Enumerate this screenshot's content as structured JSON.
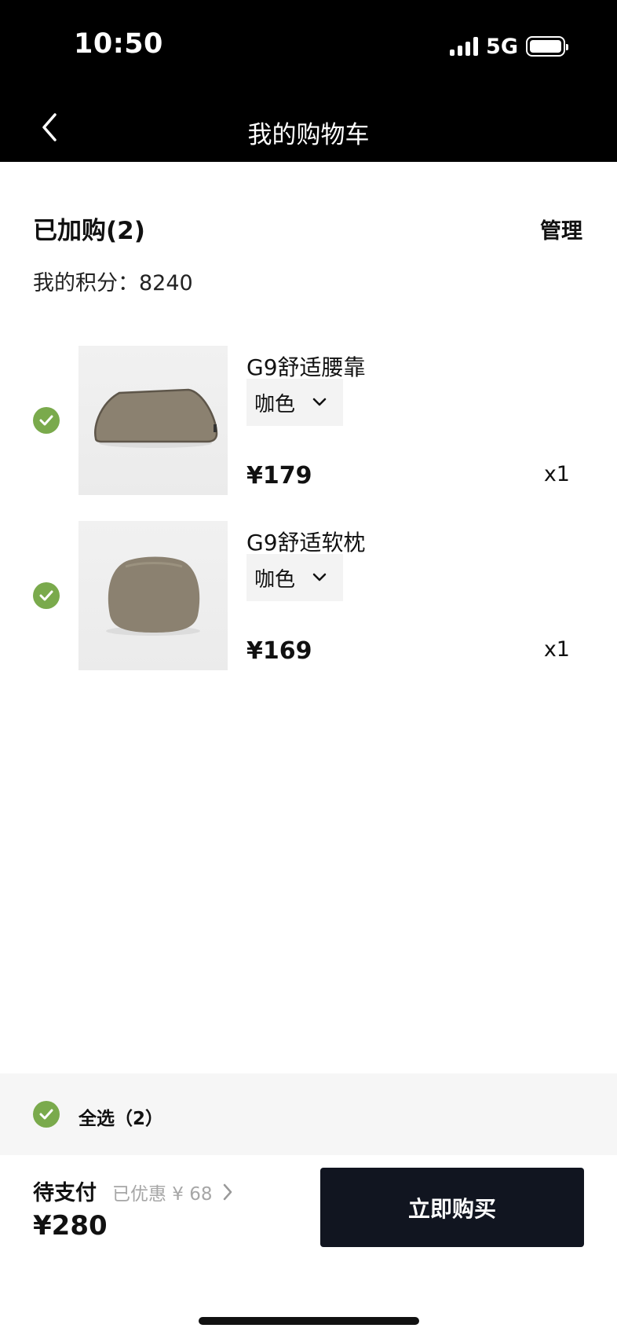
{
  "status_bar": {
    "time": "10:50",
    "network": "5G"
  },
  "nav": {
    "title": "我的购物车"
  },
  "cart": {
    "heading": "已加购(2)",
    "manage_label": "管理",
    "points_label": "我的积分：",
    "points_value": "8240"
  },
  "items": [
    {
      "name": "G9舒适腰靠",
      "color": "咖色",
      "price": "¥179",
      "qty": "x1",
      "selected": true
    },
    {
      "name": "G9舒适软枕",
      "color": "咖色",
      "price": "¥169",
      "qty": "x1",
      "selected": true
    }
  ],
  "footer": {
    "select_all_label": "全选（2）",
    "pay_label": "待支付",
    "discount_label": "已优惠 ¥ 68",
    "total": "¥280",
    "buy_label": "立即购买"
  },
  "colors": {
    "accent_green": "#7aaa4c",
    "button_dark": "#111520",
    "product_taupe": "#8b8170"
  }
}
